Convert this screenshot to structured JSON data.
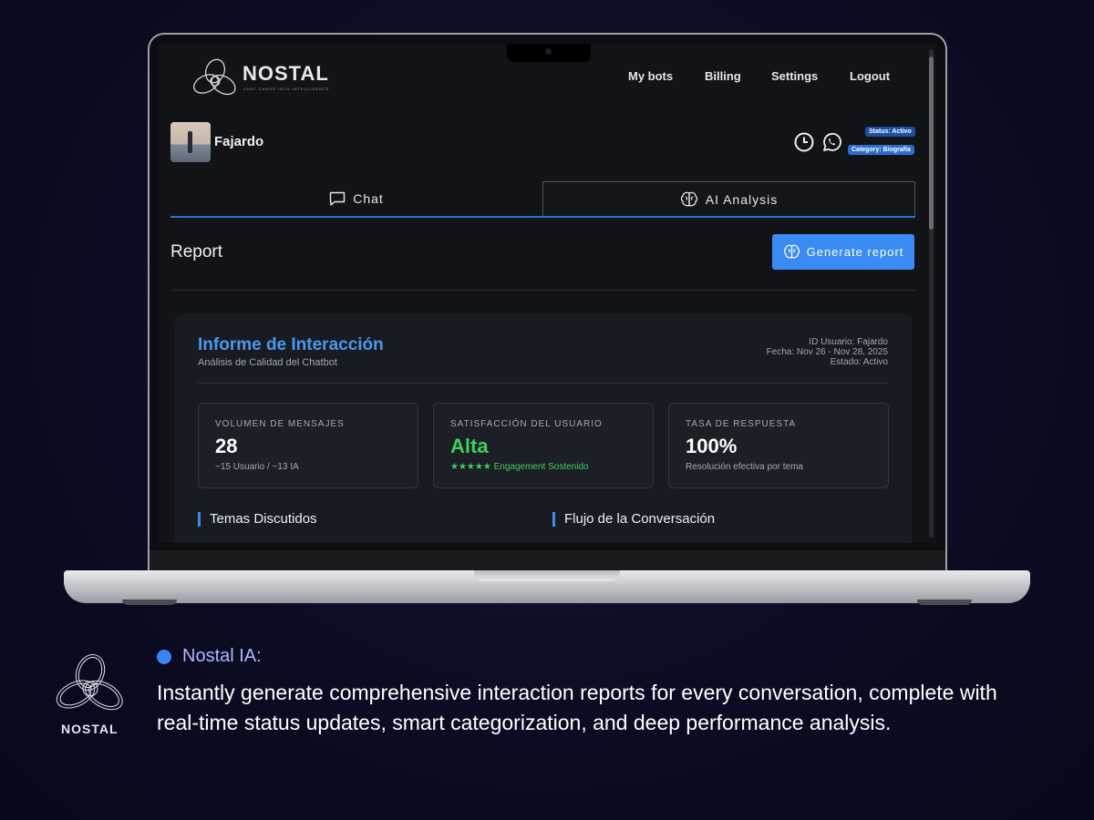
{
  "app": {
    "brand": "NOSTAL",
    "tagline": "CHAT CHAOS INTO INTELLIGENCE",
    "nav": [
      "My bots",
      "Billing",
      "Settings",
      "Logout"
    ]
  },
  "bot": {
    "name": "Fajardo",
    "status_badge": "Status: Activo",
    "category_badge": "Category: Biografía",
    "icons": [
      "clock-icon",
      "whatsapp-icon"
    ]
  },
  "tabs": [
    {
      "label": "Chat",
      "icon": "chat-bubble-icon",
      "active": false
    },
    {
      "label": "AI Analysis",
      "icon": "brain-icon",
      "active": true
    }
  ],
  "report": {
    "title": "Report",
    "generate_button": "Generate report"
  },
  "informe": {
    "title": "Informe de Interacción",
    "subtitle": "Análisis de Calidad del Chatbot",
    "meta": {
      "user_id": "ID Usuario: Fajardo",
      "date": "Fecha: Nov 26 - Nov 28, 2025",
      "state": "Estado: Activo"
    },
    "stats": [
      {
        "label": "VOLUMEN DE MENSAJES",
        "value": "28",
        "note": "~15 Usuario / ~13 IA",
        "color": "#ffffff",
        "note_color": "#a5a9b1"
      },
      {
        "label": "SATISFACCIÓN DEL USUARIO",
        "value": "Alta",
        "note": "★★★★★ Engagement Sostenido",
        "color": "#3fcf5a",
        "note_color": "#3fcf5a"
      },
      {
        "label": "TASA DE RESPUESTA",
        "value": "100%",
        "note": "Resolución efectiva por tema",
        "color": "#ffffff",
        "note_color": "#a5a9b1"
      }
    ],
    "sections": [
      "Temas Discutidos",
      "Flujo de la Conversación"
    ]
  },
  "caption": {
    "logo_word": "NOSTAL",
    "title": "Nostal IA:",
    "text": "Instantly generate comprehensive interaction reports for every conversation, complete with real-time status updates, smart categorization, and deep performance analysis."
  },
  "colors": {
    "accent": "#3b8bf5",
    "status_badge": "#1e4fa8",
    "category_badge": "#2a6fd0",
    "positive": "#3fcf5a"
  }
}
